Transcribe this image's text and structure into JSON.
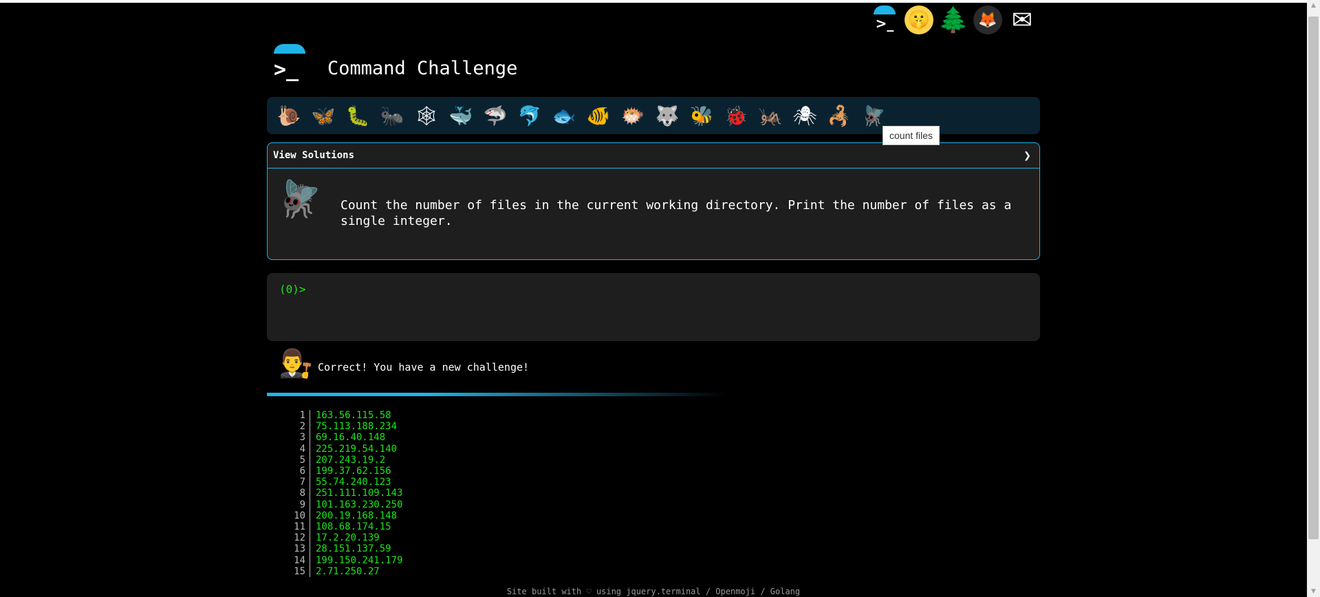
{
  "app": {
    "title": "Command Challenge",
    "logo_glyph": ">_"
  },
  "header": {
    "icons": [
      {
        "name": "terminal-icon",
        "glyph": ">_"
      },
      {
        "name": "shushing-face-icon",
        "glyph": "🤫"
      },
      {
        "name": "tree-icon",
        "glyph": "🌲"
      },
      {
        "name": "gitlab-icon",
        "glyph": "🦊"
      },
      {
        "name": "mail-icon",
        "glyph": "✉"
      }
    ]
  },
  "challenges": [
    {
      "name": "snail",
      "glyph": "🐌"
    },
    {
      "name": "butterfly",
      "glyph": "🦋"
    },
    {
      "name": "caterpillar",
      "glyph": "🐛"
    },
    {
      "name": "ant",
      "glyph": "🐜"
    },
    {
      "name": "spider-web",
      "glyph": "🕸"
    },
    {
      "name": "whale",
      "glyph": "🐳"
    },
    {
      "name": "shark",
      "glyph": "🦈"
    },
    {
      "name": "dolphin",
      "glyph": "🐬"
    },
    {
      "name": "fish",
      "glyph": "🐟"
    },
    {
      "name": "tropical-fish",
      "glyph": "🐠"
    },
    {
      "name": "blowfish",
      "glyph": "🐡"
    },
    {
      "name": "wolf",
      "glyph": "🐺"
    },
    {
      "name": "bee",
      "glyph": "🐝"
    },
    {
      "name": "ladybug",
      "glyph": "🐞"
    },
    {
      "name": "cricket",
      "glyph": "🦗"
    },
    {
      "name": "spider",
      "glyph": "🕷"
    },
    {
      "name": "scorpion",
      "glyph": "🦂"
    },
    {
      "name": "fly",
      "glyph": "🪰"
    }
  ],
  "tooltip": {
    "text": "count files"
  },
  "task": {
    "header_label": "View Solutions",
    "header_arrow": "❯",
    "icon_glyph": "🪰",
    "description": "Count the number of files in the current working directory. Print the number of files as a single integer."
  },
  "terminal": {
    "prompt": "(0)>"
  },
  "feedback": {
    "avatar_glyph": "👨‍⚖",
    "message": "Correct! You have a new challenge!"
  },
  "output": {
    "lines": [
      {
        "n": "1",
        "v": "163.56.115.58"
      },
      {
        "n": "2",
        "v": "75.113.188.234"
      },
      {
        "n": "3",
        "v": "69.16.40.148"
      },
      {
        "n": "4",
        "v": "225.219.54.140"
      },
      {
        "n": "5",
        "v": "207.243.19.2"
      },
      {
        "n": "6",
        "v": "199.37.62.156"
      },
      {
        "n": "7",
        "v": "55.74.240.123"
      },
      {
        "n": "8",
        "v": "251.111.109.143"
      },
      {
        "n": "9",
        "v": "101.163.230.250"
      },
      {
        "n": "10",
        "v": "200.19.168.148"
      },
      {
        "n": "11",
        "v": "108.68.174.15"
      },
      {
        "n": "12",
        "v": "17.2.20.139"
      },
      {
        "n": "13",
        "v": "28.151.137.59"
      },
      {
        "n": "14",
        "v": "199.150.241.179"
      },
      {
        "n": "15",
        "v": "2.71.250.27"
      }
    ]
  },
  "footer": {
    "text": "Site built with ♡ using jquery.terminal / Openmoji / Golang"
  },
  "colors": {
    "accent": "#1fb3e8",
    "prompt_green": "#19e619",
    "panel_bg": "#1e1e1e",
    "challenge_bar_bg": "#0a2230"
  }
}
